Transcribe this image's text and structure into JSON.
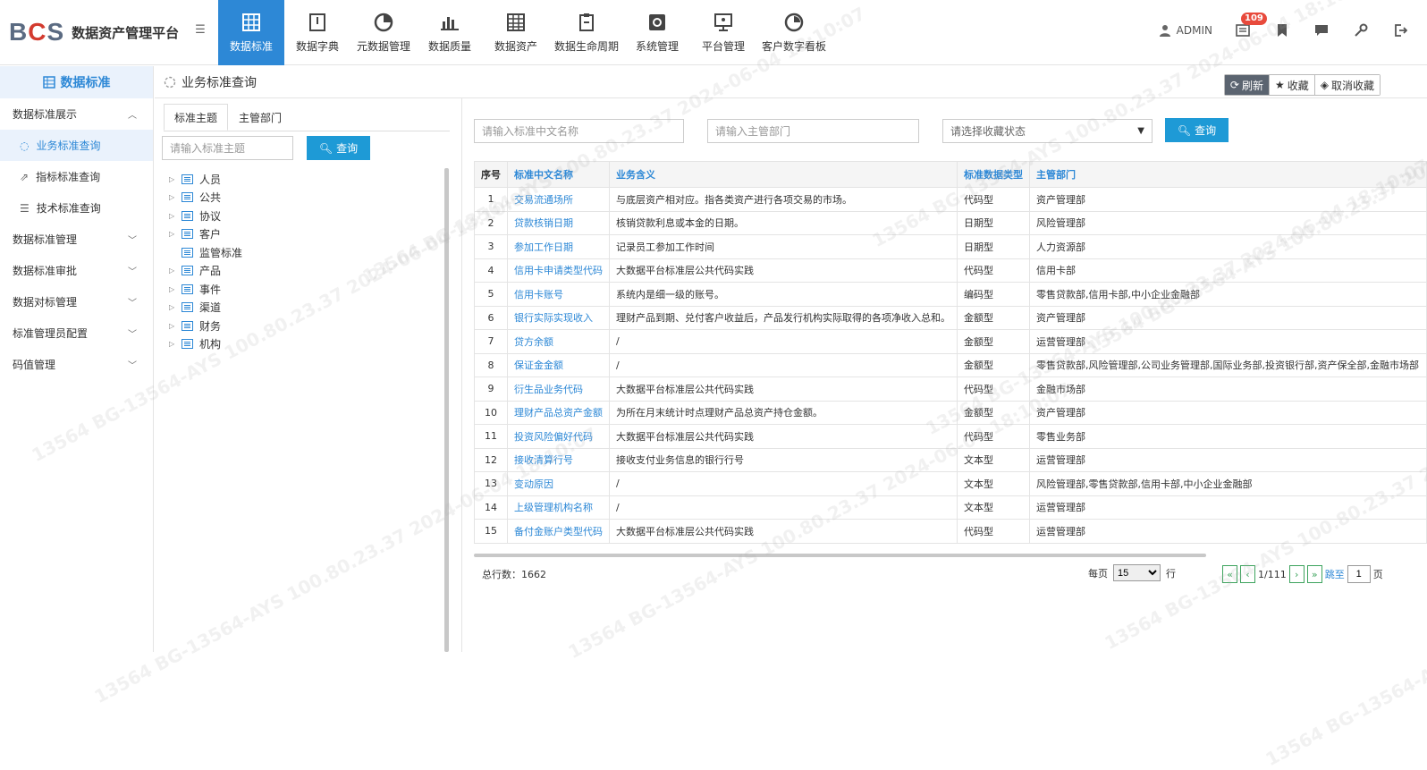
{
  "app": {
    "logo_text": "BCS",
    "title": "数据资产管理平台"
  },
  "nav": [
    {
      "label": "数据标准",
      "icon": "grid-icon",
      "active": true
    },
    {
      "label": "数据字典",
      "icon": "book-icon",
      "active": false
    },
    {
      "label": "元数据管理",
      "icon": "pie-icon",
      "active": false
    },
    {
      "label": "数据质量",
      "icon": "bar-chart-icon",
      "active": false
    },
    {
      "label": "数据资产",
      "icon": "table-icon",
      "active": false
    },
    {
      "label": "数据生命周期",
      "icon": "clipboard-icon",
      "active": false
    },
    {
      "label": "系统管理",
      "icon": "gear-icon",
      "active": false
    },
    {
      "label": "平台管理",
      "icon": "monitor-icon",
      "active": false
    },
    {
      "label": "客户数字看板",
      "icon": "dashboard-icon",
      "active": false
    }
  ],
  "toolbar": {
    "user": "ADMIN",
    "badge_count": "109"
  },
  "sidebar": {
    "header": "数据标准",
    "groups": [
      {
        "label": "数据标准展示",
        "expanded": true,
        "items": [
          {
            "label": "业务标准查询",
            "active": true
          },
          {
            "label": "指标标准查询",
            "active": false
          },
          {
            "label": "技术标准查询",
            "active": false
          }
        ]
      },
      {
        "label": "数据标准管理",
        "expanded": false
      },
      {
        "label": "数据标准审批",
        "expanded": false
      },
      {
        "label": "数据对标管理",
        "expanded": false
      },
      {
        "label": "标准管理员配置",
        "expanded": false
      },
      {
        "label": "码值管理",
        "expanded": false
      }
    ]
  },
  "breadcrumb": {
    "title": "业务标准查询",
    "refresh": "刷新",
    "favorite": "收藏",
    "unfavorite": "取消收藏"
  },
  "tree": {
    "tabs": [
      "标准主题",
      "主管部门"
    ],
    "search_placeholder": "请输入标准主题",
    "query_label": "查询",
    "nodes": [
      {
        "label": "人员",
        "expandable": true
      },
      {
        "label": "公共",
        "expandable": true
      },
      {
        "label": "协议",
        "expandable": true
      },
      {
        "label": "客户",
        "expandable": true
      },
      {
        "label": "监管标准",
        "expandable": false
      },
      {
        "label": "产品",
        "expandable": true
      },
      {
        "label": "事件",
        "expandable": true
      },
      {
        "label": "渠道",
        "expandable": true
      },
      {
        "label": "财务",
        "expandable": true
      },
      {
        "label": "机构",
        "expandable": true
      }
    ]
  },
  "filters": {
    "name_placeholder": "请输入标准中文名称",
    "dept_placeholder": "请输入主管部门",
    "status_placeholder": "请选择收藏状态",
    "query_label": "查询"
  },
  "table": {
    "columns": [
      "序号",
      "标准中文名称",
      "业务含义",
      "标准数据类型",
      "主管部门"
    ],
    "rows": [
      [
        "1",
        "交易流通场所",
        "与底层资产相对应。指各类资产进行各项交易的市场。",
        "代码型",
        "资产管理部"
      ],
      [
        "2",
        "贷款核销日期",
        "核销贷款利息或本金的日期。",
        "日期型",
        "风险管理部"
      ],
      [
        "3",
        "参加工作日期",
        "记录员工参加工作时间",
        "日期型",
        "人力资源部"
      ],
      [
        "4",
        "信用卡申请类型代码",
        "大数据平台标准层公共代码实践",
        "代码型",
        "信用卡部"
      ],
      [
        "5",
        "信用卡账号",
        "系统内是细一级的账号。",
        "编码型",
        "零售贷款部,信用卡部,中小企业金融部"
      ],
      [
        "6",
        "银行实际实现收入",
        "理财产品到期、兑付客户收益后，产品发行机构实际取得的各项净收入总和。",
        "金额型",
        "资产管理部"
      ],
      [
        "7",
        "贷方余额",
        "/",
        "金额型",
        "运营管理部"
      ],
      [
        "8",
        "保证金金额",
        "/",
        "金额型",
        "零售贷款部,风险管理部,公司业务管理部,国际业务部,投资银行部,资产保全部,金融市场部"
      ],
      [
        "9",
        "衍生品业务代码",
        "大数据平台标准层公共代码实践",
        "代码型",
        "金融市场部"
      ],
      [
        "10",
        "理财产品总资产金额",
        "为所在月末统计时点理财产品总资产持仓金额。",
        "金额型",
        "资产管理部"
      ],
      [
        "11",
        "投资风险偏好代码",
        "大数据平台标准层公共代码实践",
        "代码型",
        "零售业务部"
      ],
      [
        "12",
        "接收清算行号",
        "接收支付业务信息的银行行号",
        "文本型",
        "运营管理部"
      ],
      [
        "13",
        "变动原因",
        "/",
        "文本型",
        "风险管理部,零售贷款部,信用卡部,中小企业金融部"
      ],
      [
        "14",
        "上级管理机构名称",
        "/",
        "文本型",
        "运营管理部"
      ],
      [
        "15",
        "备付金账户类型代码",
        "大数据平台标准层公共代码实践",
        "代码型",
        "运营管理部"
      ]
    ]
  },
  "pager": {
    "total_label": "总行数：1662",
    "per_page_label": "每页",
    "per_page_value": "15",
    "row_unit": "行",
    "page_info": "1/111",
    "jump_label": "跳至",
    "page_input": "1",
    "page_unit": "页"
  },
  "watermark": "13564 BG-13564-AYS 100.80.23.37 2024-06-04 18:10:07"
}
